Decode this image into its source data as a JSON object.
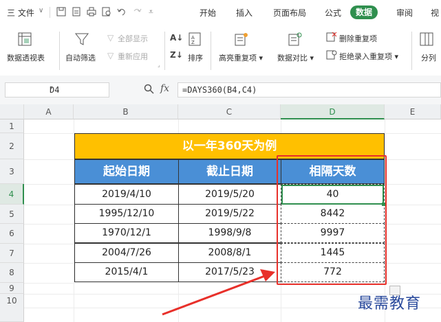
{
  "menu": {
    "file_label": "三 文件",
    "tabs": [
      "开始",
      "插入",
      "页面布局",
      "公式",
      "数据",
      "审阅",
      "视"
    ],
    "active_tab": "数据"
  },
  "ribbon": {
    "pivot": "数据透视表",
    "autofilter": "自动筛选",
    "show_all": "全部显示",
    "reapply": "重新应用",
    "sort": "排序",
    "highlight_dup": "高亮重复项",
    "compare": "数据对比",
    "remove_dup": "删除重复项",
    "reject_dup": "拒绝录入重复项",
    "split": "分列"
  },
  "formula_bar": {
    "name_box": "D4",
    "fx_label": "fx",
    "formula": "=DAYS360(B4,C4)"
  },
  "grid": {
    "columns": [
      "A",
      "B",
      "C",
      "D",
      "E"
    ],
    "rows": [
      "1",
      "2",
      "3",
      "4",
      "5",
      "6",
      "7",
      "8",
      "9",
      "10"
    ]
  },
  "table": {
    "title": "以一年360天为例",
    "headers": [
      "起始日期",
      "截止日期",
      "相隔天数"
    ],
    "rows": [
      [
        "2019/4/10",
        "2019/5/20",
        "40"
      ],
      [
        "1995/12/10",
        "2019/5/22",
        "8442"
      ],
      [
        "1970/12/1",
        "1998/9/8",
        "9997"
      ],
      [
        "2004/7/26",
        "2008/8/1",
        "1445"
      ],
      [
        "2015/4/1",
        "2017/5/23",
        "772"
      ]
    ]
  },
  "watermark": "最需教育",
  "colors": {
    "accent": "#2f8f4e",
    "title_fill": "#ffc000",
    "header_fill": "#4a8fd6",
    "highlight": "#e8302a"
  }
}
